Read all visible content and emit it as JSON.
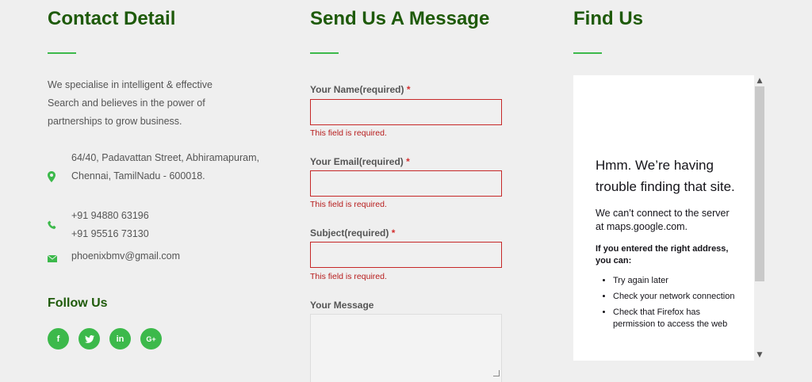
{
  "contact": {
    "heading": "Contact Detail",
    "intro": "We specialise in intelligent & effective Search and believes in the power of partnerships to grow business.",
    "address": "64/40, Padavattan Street, Abhiramapuram, Chennai, TamilNadu - 600018.",
    "phone1": "+91 94880 63196",
    "phone2": "+91 95516 73130",
    "email": "phoenixbmv@gmail.com",
    "follow_heading": "Follow Us",
    "social": [
      "f",
      "t",
      "in",
      "G+"
    ]
  },
  "form": {
    "heading": "Send Us A Message",
    "name_label": "Your Name(required)",
    "email_label": "Your Email(required)",
    "subject_label": "Subject(required)",
    "message_label": "Your Message",
    "required_marker": "*",
    "error_text": "This field is required."
  },
  "map": {
    "heading": "Find Us",
    "error_title": "Hmm. We’re having trouble finding that site.",
    "error_sub": "We can’t connect to the server at maps.google.com.",
    "advice_heading": "If you entered the right address, you can:",
    "advice_items": [
      "Try again later",
      "Check your network connection",
      "Check that Firefox has permission to access the web"
    ]
  },
  "colors": {
    "accent": "#3cb94b",
    "heading": "#1e5a0a",
    "error": "#c62828"
  }
}
